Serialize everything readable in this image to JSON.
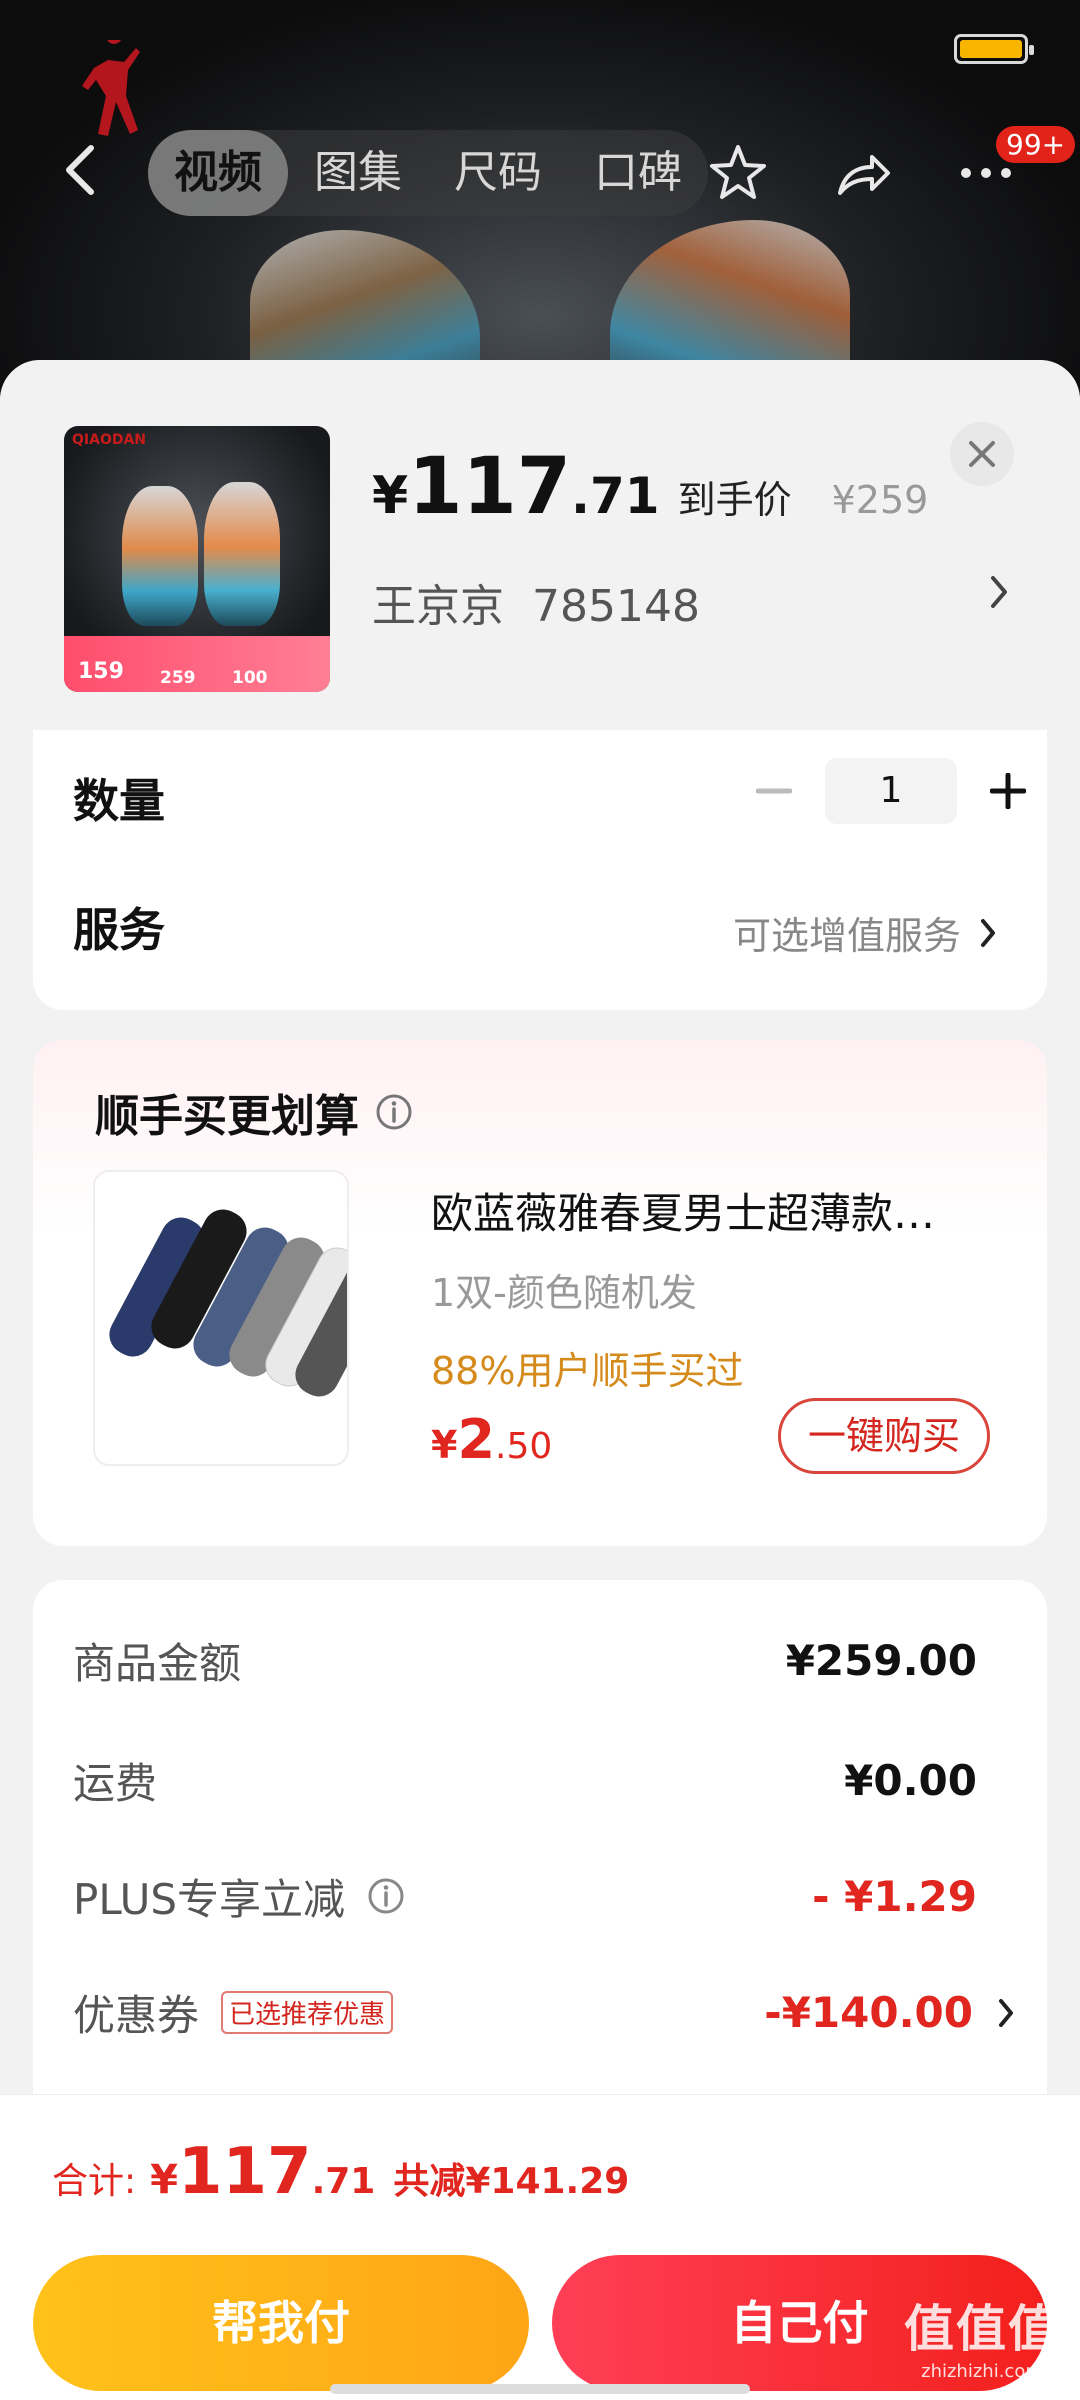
{
  "status_bar": {
    "battery_level": 1.0,
    "battery_color": "#f7b500"
  },
  "header": {
    "tabs": [
      "视频",
      "图集",
      "尺码",
      "口碑"
    ],
    "active_tab": 0,
    "cart_badge": "99+",
    "brand_logo_text": "QIAODAN"
  },
  "product": {
    "price_symbol": "¥",
    "price_int": "117",
    "price_dec": ".71",
    "price_tag": "到手价",
    "original_price": "¥259",
    "seller_name": "王京京",
    "seller_code": "785148",
    "thumb_brand": "QIAODAN",
    "thumb_prices": [
      "159",
      "259",
      "100"
    ]
  },
  "quantity": {
    "label": "数量",
    "value": "1"
  },
  "service": {
    "label": "服务",
    "value": "可选增值服务"
  },
  "upsell": {
    "title": "顺手买更划算",
    "item_title": "欧蓝薇雅春夏男士超薄款…",
    "item_spec": "1双-颜色随机发",
    "item_social": "88%用户顺手买过",
    "price_symbol": "¥",
    "price_int": "2",
    "price_dec": ".50",
    "buy_label": "一键购买"
  },
  "fees": [
    {
      "label": "商品金额",
      "value": "¥259.00",
      "red": false
    },
    {
      "label": "运费",
      "value": "¥0.00",
      "red": false
    },
    {
      "label": "PLUS专享立减",
      "value": "- ¥1.29",
      "red": true
    },
    {
      "label": "优惠券",
      "tag": "已选推荐优惠",
      "value": "-¥140.00",
      "red": true
    }
  ],
  "bottom": {
    "total_label": "合计:",
    "total_symbol": "¥",
    "total_int": "117",
    "total_dec": ".71",
    "total_saving": "共减¥141.29",
    "help_pay": "帮我付",
    "self_pay": "自己付"
  },
  "watermark": {
    "line1": "值值值",
    "line2": "zhizhizhi.com"
  },
  "colors": {
    "accent_red": "#e0261e",
    "help_yellow": "#ffb81a",
    "self_red": "#f3201c"
  }
}
